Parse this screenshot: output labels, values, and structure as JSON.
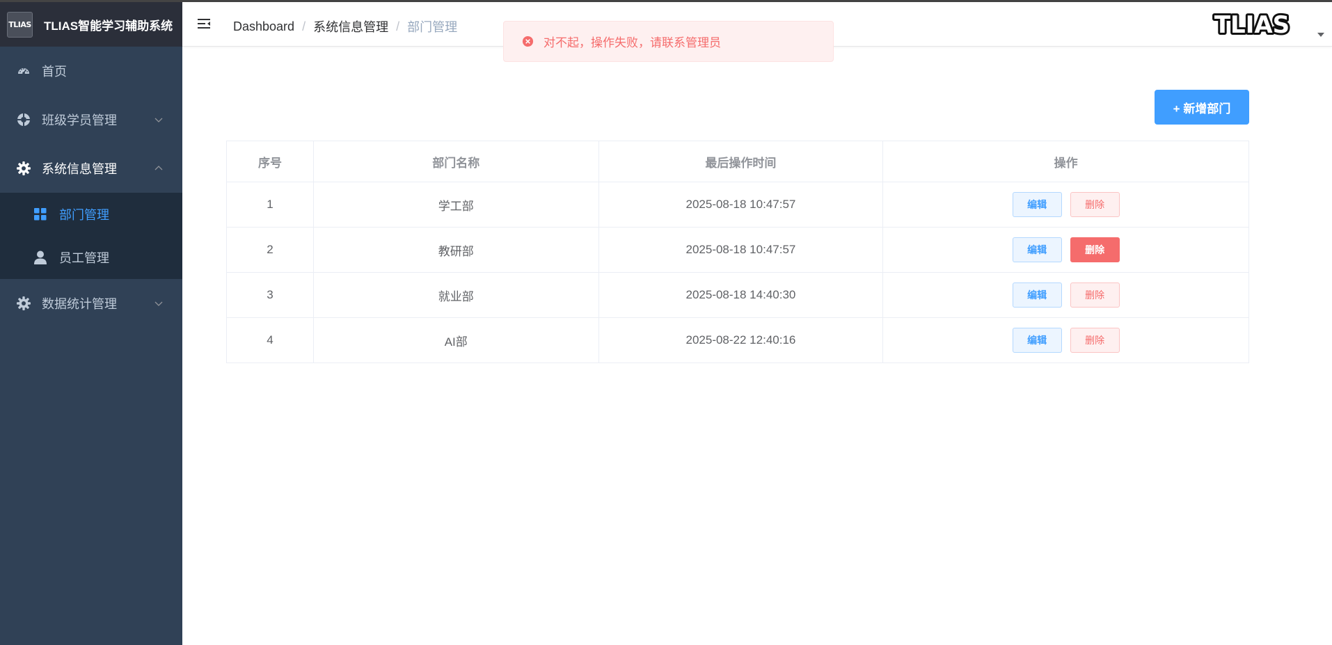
{
  "app": {
    "logo_mark": "TLIAS",
    "title": "TLIAS智能学习辅助系统",
    "brand_logo_text": "TLIAS"
  },
  "sidebar": {
    "items": [
      {
        "label": "首页",
        "icon": "dashboard-icon"
      },
      {
        "label": "班级学员管理",
        "icon": "help-circle-icon",
        "expanded": false
      },
      {
        "label": "系统信息管理",
        "icon": "gear-icon",
        "expanded": true,
        "children": [
          {
            "label": "部门管理",
            "icon": "grid-icon",
            "active": true
          },
          {
            "label": "员工管理",
            "icon": "user-icon",
            "active": false
          }
        ]
      },
      {
        "label": "数据统计管理",
        "icon": "gear-icon",
        "expanded": false
      }
    ]
  },
  "breadcrumb": [
    "Dashboard",
    "系统信息管理",
    "部门管理"
  ],
  "message": {
    "type": "error",
    "text": "对不起，操作失败，请联系管理员"
  },
  "toolbar": {
    "add_label": "+ 新增部门"
  },
  "table": {
    "headers": [
      "序号",
      "部门名称",
      "最后操作时间",
      "操作"
    ],
    "rows": [
      {
        "index": "1",
        "name": "学工部",
        "updated": "2025-08-18 10:47:57"
      },
      {
        "index": "2",
        "name": "教研部",
        "updated": "2025-08-18 10:47:57"
      },
      {
        "index": "3",
        "name": "就业部",
        "updated": "2025-08-18 14:40:30"
      },
      {
        "index": "4",
        "name": "AI部",
        "updated": "2025-08-22 12:40:16"
      }
    ],
    "edit_label": "编辑",
    "delete_label": "删除"
  },
  "colors": {
    "sidebar_bg": "#304156",
    "primary": "#409eff",
    "danger": "#f56c6c"
  }
}
